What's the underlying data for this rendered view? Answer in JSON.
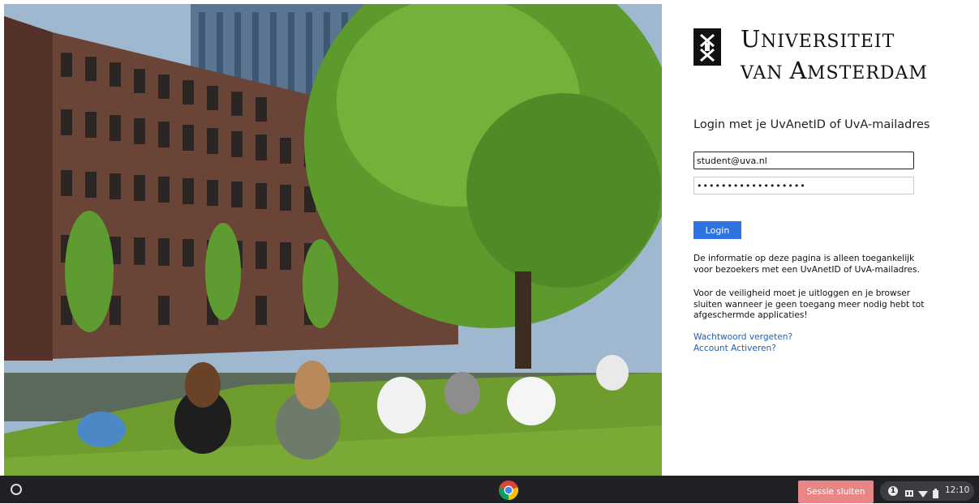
{
  "logo": {
    "line1_initial": "U",
    "line1_rest": "NIVERSITEIT",
    "line2_word": "VAN ",
    "line2_initial": "A",
    "line2_rest": "MSTERDAM"
  },
  "login": {
    "heading": "Login met je UvAnetID of UvA-mailadres",
    "email_value": "student@uva.nl",
    "password_value": "••••••••••••••••••",
    "button_label": "Login"
  },
  "info": {
    "paragraph1_line1": "De informatie op deze pagina is alleen toegankelijk",
    "paragraph1_line2": "voor bezoekers met een UvAnetID of UvA-mailadres.",
    "paragraph2_line1": "Voor de veiligheid moet je uitloggen en je browser",
    "paragraph2_line2": "sluiten wanneer je geen toegang meer nodig hebt tot",
    "paragraph2_line3": "afgeschermde applicaties!"
  },
  "links": {
    "forgot_password": "Wachtwoord vergeten?",
    "activate_account": "Account Activeren?"
  },
  "shelf": {
    "end_session_label": "Sessie sluiten",
    "notification_count": "1",
    "clock": "12:10"
  },
  "icons": {
    "launcher": "launcher-icon",
    "browser": "chrome-icon",
    "wifi": "wifi-icon",
    "battery": "battery-icon",
    "network": "network-icon"
  },
  "colors": {
    "login_button": "#2f73e0",
    "link": "#1f5fb8",
    "end_session": "#e88585",
    "shelf": "#202124"
  }
}
